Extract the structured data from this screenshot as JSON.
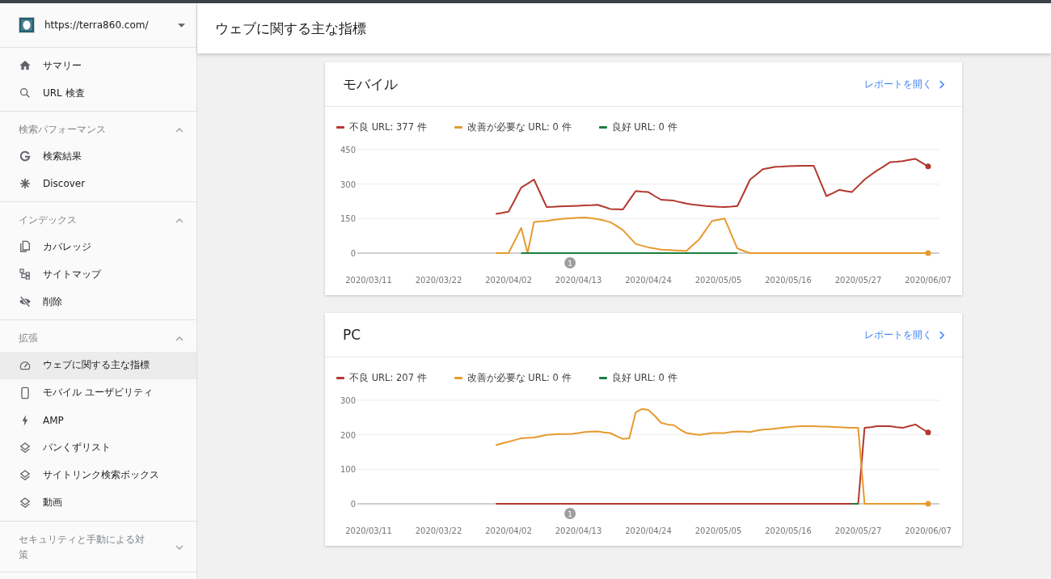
{
  "property": {
    "url": "https://terra860.com/"
  },
  "sidebar": {
    "sections": [
      {
        "items": [
          {
            "label": "サマリー",
            "selected": false
          },
          {
            "label": "URL 検査",
            "selected": false
          }
        ]
      },
      {
        "title": "検索パフォーマンス",
        "expanded": true,
        "items": [
          {
            "label": "検索結果",
            "selected": false
          },
          {
            "label": "Discover",
            "selected": false
          }
        ]
      },
      {
        "title": "インデックス",
        "expanded": true,
        "items": [
          {
            "label": "カバレッジ",
            "selected": false
          },
          {
            "label": "サイトマップ",
            "selected": false
          },
          {
            "label": "削除",
            "selected": false
          }
        ]
      },
      {
        "title": "拡張",
        "expanded": true,
        "items": [
          {
            "label": "ウェブに関する主な指標",
            "selected": true
          },
          {
            "label": "モバイル ユーザビリティ",
            "selected": false
          },
          {
            "label": "AMP",
            "selected": false
          },
          {
            "label": "パンくずリスト",
            "selected": false
          },
          {
            "label": "サイトリンク検索ボックス",
            "selected": false
          },
          {
            "label": "動画",
            "selected": false
          }
        ]
      },
      {
        "title": "セキュリティと手動による対策",
        "expanded": false
      }
    ]
  },
  "page_title": "ウェブに関する主な指標",
  "cards": [
    {
      "title": "モバイル",
      "link": "レポートを開く",
      "chart_data": {
        "type": "line",
        "categories": [
          "2020/03/11",
          null,
          null,
          null,
          null,
          null,
          null,
          null,
          null,
          null,
          null,
          "2020/03/22",
          null,
          null,
          null,
          null,
          null,
          null,
          null,
          null,
          null,
          null,
          "2020/04/02",
          null,
          null,
          null,
          null,
          null,
          null,
          null,
          null,
          null,
          null,
          "2020/04/13",
          null,
          null,
          null,
          null,
          null,
          null,
          null,
          null,
          null,
          null,
          "2020/04/24",
          null,
          null,
          null,
          null,
          null,
          null,
          null,
          null,
          null,
          null,
          "2020/05/05",
          null,
          null,
          null,
          null,
          null,
          null,
          null,
          null,
          null,
          null,
          "2020/05/16",
          null,
          null,
          null,
          null,
          null,
          null,
          null,
          null,
          null,
          null,
          "2020/05/27",
          null,
          null,
          null,
          null,
          null,
          null,
          null,
          null,
          null,
          null,
          "2020/06/07"
        ],
        "ylim": [
          0,
          450
        ],
        "yticks": [
          0,
          150,
          300,
          450
        ],
        "series": [
          {
            "name": "不良 URL: 377 件",
            "color": "#b3382e",
            "values": [
              null,
              null,
              null,
              null,
              null,
              null,
              null,
              null,
              null,
              null,
              null,
              null,
              null,
              null,
              null,
              null,
              null,
              null,
              null,
              null,
              170,
              175,
              180,
              232,
              285,
              302,
              320,
              260,
              200,
              201,
              203,
              204,
              205,
              206,
              207,
              208,
              210,
              201,
              192,
              191,
              190,
              230,
              270,
              267,
              265,
              248,
              232,
              230,
              228,
              221,
              215,
              211,
              208,
              205,
              203,
              201,
              200,
              202,
              205,
              262,
              320,
              342,
              365,
              370,
              375,
              376,
              378,
              379,
              380,
              380,
              380,
              314,
              248,
              261,
              275,
              270,
              265,
              292,
              320,
              340,
              360,
              377,
              395,
              397,
              400,
              405,
              410,
              393,
              377
            ]
          },
          {
            "name": "改善が必要な URL: 0 件",
            "color": "#e69a2e",
            "values": [
              null,
              null,
              null,
              null,
              null,
              null,
              null,
              null,
              null,
              null,
              null,
              null,
              null,
              null,
              null,
              null,
              null,
              null,
              null,
              null,
              0,
              0,
              0,
              55,
              110,
              0,
              135,
              138,
              140,
              144,
              148,
              150,
              152,
              154,
              155,
              152,
              148,
              142,
              135,
              118,
              100,
              70,
              40,
              32,
              25,
              20,
              15,
              14,
              12,
              11,
              10,
              35,
              60,
              100,
              140,
              145,
              150,
              85,
              20,
              10,
              0,
              0,
              0,
              0,
              0,
              0,
              0,
              0,
              0,
              0,
              0,
              0,
              0,
              0,
              0,
              0,
              0,
              0,
              0,
              0,
              0,
              0,
              0,
              0,
              0,
              0,
              0,
              0,
              0
            ]
          },
          {
            "name": "良好 URL: 0 件",
            "color": "#1e7d3f",
            "values": [
              null,
              null,
              null,
              null,
              null,
              null,
              null,
              null,
              null,
              null,
              null,
              null,
              null,
              null,
              null,
              null,
              null,
              null,
              null,
              null,
              null,
              null,
              null,
              null,
              0,
              0,
              0,
              0,
              0,
              0,
              0,
              0,
              0,
              0,
              0,
              0,
              0,
              0,
              0,
              0,
              0,
              0,
              0,
              0,
              0,
              0,
              0,
              0,
              0,
              0,
              0,
              0,
              0,
              0,
              0,
              0,
              0,
              0,
              0,
              null,
              null,
              null,
              null,
              null,
              null,
              null,
              null,
              null,
              null,
              null,
              null,
              null,
              null,
              null,
              null,
              null,
              null,
              null,
              null,
              null,
              null,
              null,
              null,
              null,
              null,
              null,
              null,
              null,
              null
            ]
          }
        ],
        "annotations": [
          "1"
        ]
      }
    },
    {
      "title": "PC",
      "link": "レポートを開く",
      "chart_data": {
        "type": "line",
        "categories": [
          "2020/03/11",
          null,
          null,
          null,
          null,
          null,
          null,
          null,
          null,
          null,
          null,
          "2020/03/22",
          null,
          null,
          null,
          null,
          null,
          null,
          null,
          null,
          null,
          null,
          "2020/04/02",
          null,
          null,
          null,
          null,
          null,
          null,
          null,
          null,
          null,
          null,
          "2020/04/13",
          null,
          null,
          null,
          null,
          null,
          null,
          null,
          null,
          null,
          null,
          "2020/04/24",
          null,
          null,
          null,
          null,
          null,
          null,
          null,
          null,
          null,
          null,
          "2020/05/05",
          null,
          null,
          null,
          null,
          null,
          null,
          null,
          null,
          null,
          null,
          "2020/05/16",
          null,
          null,
          null,
          null,
          null,
          null,
          null,
          null,
          null,
          null,
          "2020/05/27",
          null,
          null,
          null,
          null,
          null,
          null,
          null,
          null,
          null,
          null,
          "2020/06/07"
        ],
        "ylim": [
          0,
          300
        ],
        "yticks": [
          0,
          100,
          200,
          300
        ],
        "series": [
          {
            "name": "不良 URL: 207 件",
            "color": "#b3382e",
            "values": [
              null,
              null,
              null,
              null,
              null,
              null,
              null,
              null,
              null,
              null,
              null,
              null,
              null,
              null,
              null,
              null,
              null,
              null,
              null,
              null,
              0,
              0,
              0,
              0,
              0,
              0,
              0,
              0,
              0,
              0,
              0,
              0,
              0,
              0,
              0,
              0,
              0,
              0,
              0,
              0,
              0,
              0,
              0,
              0,
              0,
              0,
              0,
              0,
              0,
              0,
              0,
              0,
              0,
              0,
              0,
              0,
              0,
              0,
              0,
              0,
              0,
              0,
              0,
              0,
              0,
              0,
              0,
              0,
              0,
              0,
              0,
              0,
              0,
              0,
              0,
              0,
              0,
              0,
              220,
              222,
              225,
              225,
              225,
              222,
              220,
              225,
              230,
              218,
              207
            ]
          },
          {
            "name": "改善が必要な URL: 0 件",
            "color": "#e69a2e",
            "values": [
              null,
              null,
              null,
              null,
              null,
              null,
              null,
              null,
              null,
              null,
              null,
              null,
              null,
              null,
              null,
              null,
              null,
              null,
              null,
              null,
              170,
              175,
              180,
              185,
              190,
              191,
              192,
              196,
              200,
              201,
              202,
              202,
              203,
              205,
              208,
              209,
              210,
              207,
              205,
              196,
              188,
              190,
              265,
              275,
              272,
              255,
              235,
              230,
              228,
              215,
              205,
              202,
              200,
              202,
              205,
              205,
              205,
              208,
              210,
              209,
              208,
              212,
              215,
              216,
              218,
              220,
              222,
              224,
              225,
              225,
              225,
              224,
              224,
              223,
              222,
              221,
              220,
              220,
              0,
              0,
              0,
              0,
              0,
              0,
              0,
              0,
              0,
              0,
              0
            ]
          },
          {
            "name": "良好 URL: 0 件",
            "color": "#1e7d3f",
            "values": [
              null,
              null,
              null,
              null,
              null,
              null,
              null,
              null,
              null,
              null,
              null,
              null,
              null,
              null,
              null,
              null,
              null,
              null,
              null,
              null,
              null,
              null,
              null,
              null,
              null,
              null,
              null,
              null,
              null,
              null,
              null,
              null,
              null,
              null,
              null,
              null,
              null,
              null,
              null,
              null,
              null,
              null,
              null,
              null,
              null,
              null,
              null,
              null,
              null,
              null,
              null,
              null,
              null,
              null,
              null,
              null,
              null,
              null,
              null,
              null,
              null,
              null,
              null,
              null,
              null,
              null,
              null,
              null,
              null,
              null,
              null,
              null,
              null,
              null,
              null,
              null,
              0,
              0,
              null,
              null,
              null,
              null,
              null,
              null,
              null,
              null,
              null,
              null,
              null
            ]
          }
        ],
        "annotations": [
          "1"
        ]
      }
    }
  ]
}
